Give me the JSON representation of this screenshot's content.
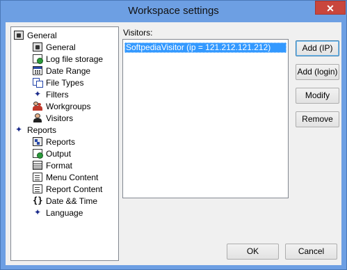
{
  "window": {
    "title": "Workspace settings",
    "close_glyph": "✕"
  },
  "tree": {
    "items": [
      {
        "label": "General",
        "icon": "settings-icon",
        "level": 0
      },
      {
        "label": "General",
        "icon": "settings-icon",
        "level": 1
      },
      {
        "label": "Log file storage",
        "icon": "globe-doc-icon",
        "level": 1
      },
      {
        "label": "Date Range",
        "icon": "calendar-icon",
        "level": 1
      },
      {
        "label": "File Types",
        "icon": "files-icon",
        "level": 1
      },
      {
        "label": "Filters",
        "icon": "star-icon",
        "level": 1
      },
      {
        "label": "Workgroups",
        "icon": "users-icon",
        "level": 1
      },
      {
        "label": "Visitors",
        "icon": "user-icon",
        "level": 1
      },
      {
        "label": "Reports",
        "icon": "star-icon",
        "level": 0
      },
      {
        "label": "Reports",
        "icon": "tree-folder-icon",
        "level": 1
      },
      {
        "label": "Output",
        "icon": "output-icon",
        "level": 1
      },
      {
        "label": "Format",
        "icon": "table-icon",
        "level": 1
      },
      {
        "label": "Menu Content",
        "icon": "document-icon",
        "level": 1
      },
      {
        "label": "Report Content",
        "icon": "document-icon",
        "level": 1
      },
      {
        "label": "Date && Time",
        "icon": "braces-icon",
        "level": 1
      },
      {
        "label": "Language",
        "icon": "star-icon",
        "level": 1
      }
    ]
  },
  "visitors": {
    "label": "Visitors:",
    "items": [
      "SoftpediaVisitor (ip = 121.212.121.212)"
    ]
  },
  "buttons": {
    "add_ip": "Add (IP)",
    "add_login": "Add (login)",
    "modify": "Modify",
    "remove": "Remove",
    "ok": "OK",
    "cancel": "Cancel"
  },
  "colors": {
    "title_bar": "#6d9fe3",
    "selection": "#3399ff",
    "close_button": "#c9463d"
  }
}
